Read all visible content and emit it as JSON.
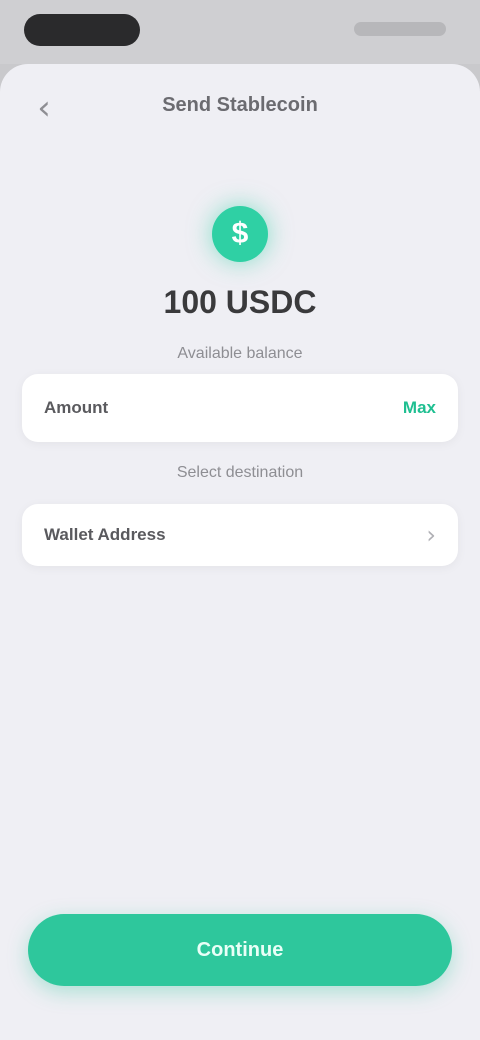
{
  "status_bar": {},
  "nav": {
    "back_glyph": "‹",
    "title": "Send Stablecoin"
  },
  "hero": {
    "icon_glyph": "$",
    "title": "100 USDC",
    "subtitle": "Available balance"
  },
  "amount": {
    "label": "Amount",
    "value": "Max",
    "accent_color": "#1fbf91"
  },
  "destination": {
    "section_label": "Select destination",
    "selected": "Wallet Address",
    "chevron_glyph": "›"
  },
  "confirm": {
    "label": "Continue",
    "color": "#2ec79c"
  }
}
